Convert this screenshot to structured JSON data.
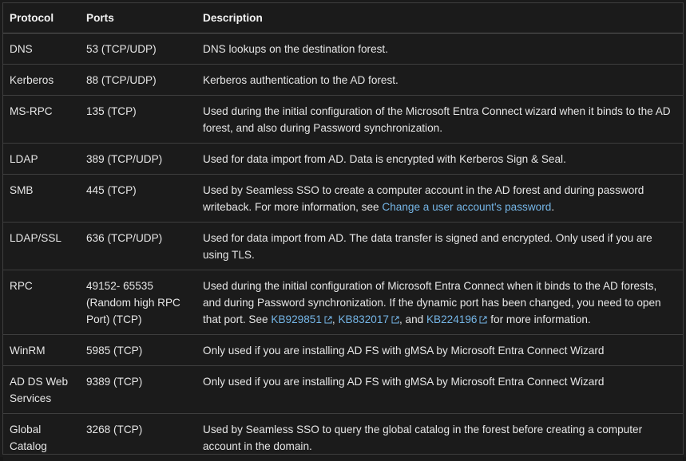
{
  "table": {
    "headers": {
      "protocol": "Protocol",
      "ports": "Ports",
      "description": "Description"
    },
    "rows": [
      {
        "protocol": "DNS",
        "ports": "53 (TCP/UDP)",
        "description": "DNS lookups on the destination forest."
      },
      {
        "protocol": "Kerberos",
        "ports": "88 (TCP/UDP)",
        "description": "Kerberos authentication to the AD forest."
      },
      {
        "protocol": "MS-RPC",
        "ports": "135 (TCP)",
        "description": "Used during the initial configuration of the Microsoft Entra Connect wizard when it binds to the AD forest, and also during Password synchronization."
      },
      {
        "protocol": "LDAP",
        "ports": "389 (TCP/UDP)",
        "description": "Used for data import from AD. Data is encrypted with Kerberos Sign & Seal."
      },
      {
        "protocol": "SMB",
        "ports": "445 (TCP)",
        "description_pre": "Used by Seamless SSO to create a computer account in the AD forest and during password writeback. For more information, see ",
        "description_link": "Change a user account's password",
        "description_post": "."
      },
      {
        "protocol": "LDAP/SSL",
        "ports": "636 (TCP/UDP)",
        "description": "Used for data import from AD. The data transfer is signed and encrypted. Only used if you are using TLS."
      },
      {
        "protocol": "RPC",
        "ports": "49152- 65535 (Random high RPC Port) (TCP)",
        "description_pre": "Used during the initial configuration of Microsoft Entra Connect when it binds to the AD forests, and during Password synchronization. If the dynamic port has been changed, you need to open that port. See ",
        "links": [
          "KB929851",
          "KB832017",
          "KB224196"
        ],
        "sep1": ", ",
        "sep2": ", and ",
        "description_post": " for more information."
      },
      {
        "protocol": "WinRM",
        "ports": "5985 (TCP)",
        "description": "Only used if you are installing AD FS with gMSA by Microsoft Entra Connect Wizard"
      },
      {
        "protocol": "AD DS Web Services",
        "ports": "9389 (TCP)",
        "description": "Only used if you are installing AD FS with gMSA by Microsoft Entra Connect Wizard"
      },
      {
        "protocol": "Global Catalog",
        "ports": "3268 (TCP)",
        "description": "Used by Seamless SSO to query the global catalog in the forest before creating a computer account in the domain."
      }
    ]
  },
  "colors": {
    "background": "#1b1b1b",
    "text": "#e6e6e6",
    "link": "#75b6e7",
    "border": "#3e3e3e"
  },
  "icons": {
    "external_link": "external-link-icon"
  }
}
